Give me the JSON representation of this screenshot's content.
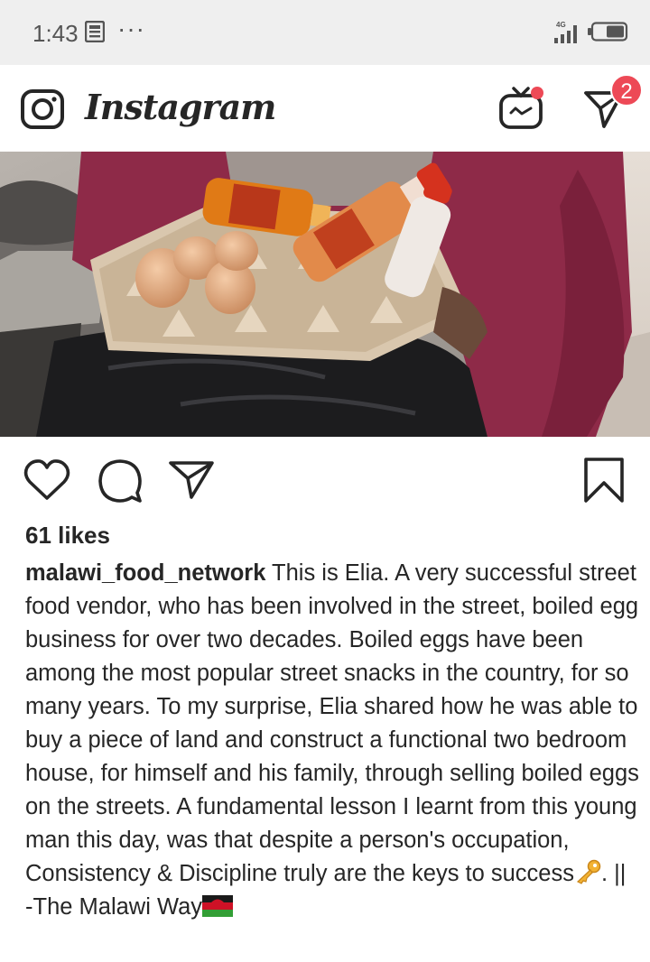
{
  "status_bar": {
    "time": "1:43",
    "network": "4G"
  },
  "app_bar": {
    "logo": "Instagram",
    "direct_badge_count": "2"
  },
  "post": {
    "likes": "61 likes",
    "username": "malawi_food_network",
    "caption_text": "This is Elia. A very successful street food vendor, who has been involved in the street, boiled egg business for over two decades. Boiled eggs have been among the most popular street snacks in the country, for so many years. To my surprise, Elia shared how he was able to buy a piece of land and construct a functional two bedroom house, for himself and his family, through selling boiled eggs on the streets. A fundamental lesson I learnt from this young man this day, was that despite a person's  occupation, Consistency & Discipline truly are the keys to success",
    "caption_tail": ". || -The Malawi Way",
    "emoji": [
      "key",
      "malawi-flag"
    ]
  },
  "colors": {
    "accent_red": "#ed4956",
    "text": "#262626",
    "status_bar_bg": "#efefef"
  }
}
